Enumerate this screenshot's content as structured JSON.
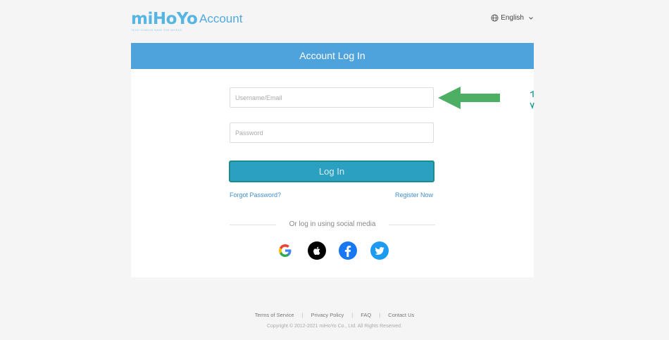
{
  "header": {
    "logo_text": "miHoYo",
    "logo_tagline": "TECH OTAKUS SAVE THE WORLD",
    "account_label": "Account",
    "language": "English"
  },
  "login": {
    "title": "Account Log In",
    "username_placeholder": "Username/Email",
    "password_placeholder": "Password",
    "login_button": "Log In",
    "forgot_password": "Forgot Password?",
    "register": "Register Now",
    "social_divider": "Or log in using social media",
    "social": [
      "google",
      "apple",
      "facebook",
      "twitter"
    ]
  },
  "footer": {
    "links": [
      "Terms of Service",
      "Privacy Policy",
      "FAQ",
      "Contact Us"
    ],
    "copyright": "Copyright © 2012-2021 miHoYo Co., Ltd. All Rights Reserved."
  },
  "colors": {
    "brand": "#4fa3dd",
    "login_button": "#2ca0c1",
    "annotation_arrow": "#4caf63"
  }
}
